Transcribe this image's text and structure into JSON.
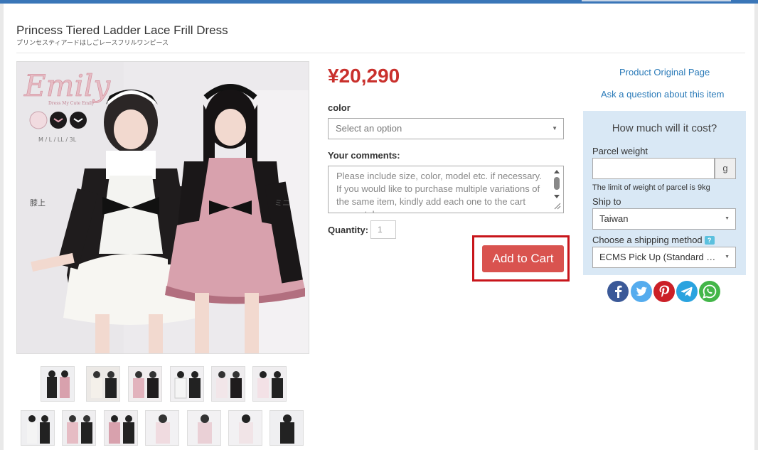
{
  "product": {
    "title": "Princess Tiered Ladder Lace Frill Dress",
    "subtitle": "プリンセスティアードはしごレースフリルワンピース",
    "price": "¥20,290"
  },
  "image": {
    "brand": "Emily",
    "brand_tagline": "Dress My Cute Emily",
    "sizes": "M / L / LL / 3L",
    "label_knee": "膝上",
    "label_mini": "ミニ"
  },
  "options": {
    "color_label": "color",
    "color_placeholder": "Select an option",
    "comments_label": "Your comments:",
    "comments_placeholder": "Please include size, color, model etc. if necessary. If you would like to purchase multiple variations of the same item, kindly add each one to the cart separately.",
    "quantity_label": "Quantity:",
    "quantity_value": "1",
    "add_to_cart": "Add to Cart"
  },
  "links": {
    "original_page": "Product Original Page",
    "ask_question": "Ask a question about this item"
  },
  "calculator": {
    "title": "How much will it cost?",
    "parcel_weight_label": "Parcel weight",
    "weight_unit": "g",
    "weight_note": "The limit of weight of parcel is 9kg",
    "ship_to_label": "Ship to",
    "ship_to_value": "Taiwan",
    "shipping_method_label": "Choose a shipping method",
    "help_mark": "?",
    "shipping_method_value": "ECMS Pick Up (Standard Parcel)"
  },
  "social": {
    "icons": [
      "facebook-icon",
      "twitter-icon",
      "pinterest-icon",
      "telegram-icon",
      "whatsapp-icon"
    ]
  },
  "colors": {
    "accent_blue": "#3a76b8",
    "price_red": "#c9302c",
    "button_red": "#d9534f",
    "highlight_frame": "#c8151b",
    "panel_blue": "#d9e8f5",
    "link_blue": "#2a7ab8"
  }
}
